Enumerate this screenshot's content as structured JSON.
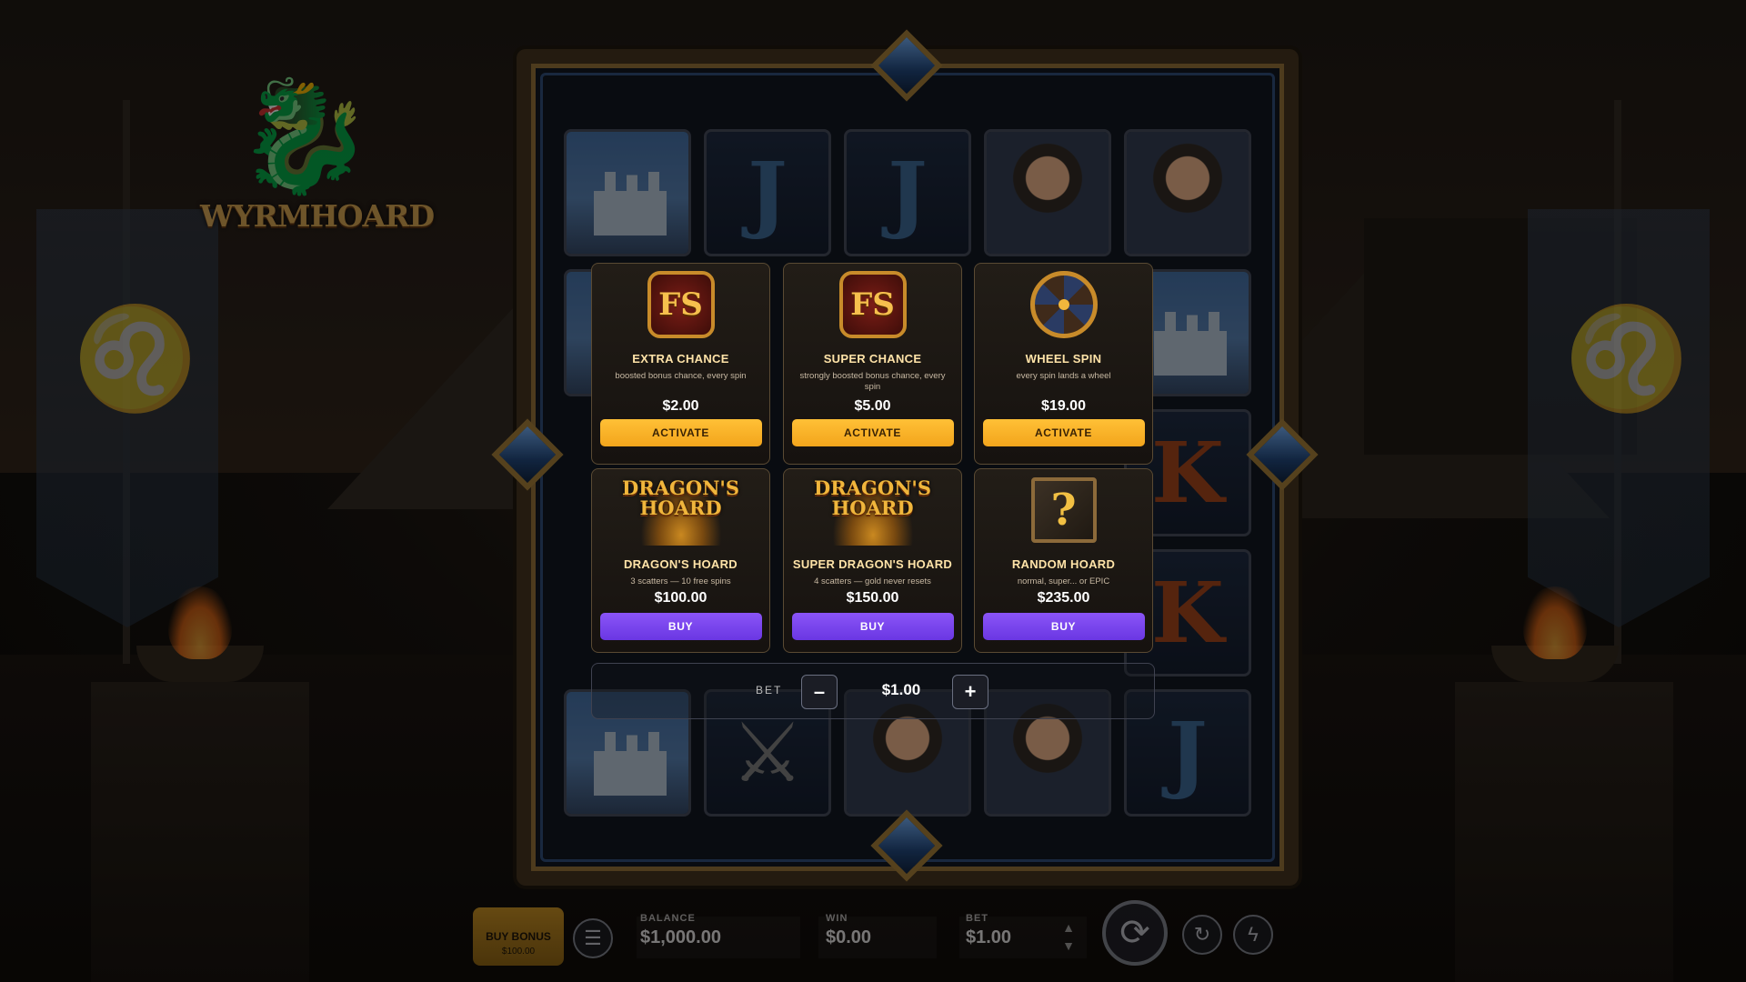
{
  "logo": {
    "text": "WYRMHOARD"
  },
  "shop": {
    "boosts": [
      {
        "title": "EXTRA CHANCE",
        "desc": "boosted bonus chance, every spin",
        "price": "$2.00",
        "button": "ACTIVATE",
        "icon": "fs-scatter-icon",
        "icon_text": "FS"
      },
      {
        "title": "SUPER CHANCE",
        "desc": "strongly boosted bonus chance, every spin",
        "price": "$5.00",
        "button": "ACTIVATE",
        "icon": "fs-scatter-icon",
        "icon_text": "FS"
      },
      {
        "title": "WHEEL SPIN",
        "desc": "every spin lands a wheel",
        "price": "$19.00",
        "button": "ACTIVATE",
        "icon": "wheel-icon"
      }
    ],
    "bonuses": [
      {
        "title": "DRAGON'S HOARD",
        "desc": "3 scatters — 10 free spins",
        "price": "$100.00",
        "button": "BUY",
        "icon": "dragons-hoard-icon",
        "icon_line1": "DRAGON'S",
        "icon_line2": "HOARD"
      },
      {
        "title": "SUPER DRAGON'S HOARD",
        "desc": "4 scatters — gold never resets",
        "price": "$150.00",
        "button": "BUY",
        "icon": "dragons-hoard-icon",
        "icon_line1": "DRAGON'S",
        "icon_line2": "HOARD"
      },
      {
        "title": "RANDOM HOARD",
        "desc": "normal, super... or EPIC",
        "price": "$235.00",
        "button": "BUY",
        "icon": "mystery-box-icon",
        "icon_text": "?"
      }
    ],
    "bet": {
      "label": "BET",
      "value": "$1.00",
      "minus": "–",
      "plus": "+"
    }
  },
  "hud": {
    "buy_bonus": {
      "label": "BUY BONUS",
      "price": "$100.00"
    },
    "balance": {
      "label": "BALANCE",
      "value": "$1,000.00"
    },
    "win": {
      "label": "WIN",
      "value": "$0.00"
    },
    "bet": {
      "label": "BET",
      "value": "$1.00"
    }
  },
  "colors": {
    "activate": "#f3a51c",
    "buy": "#6a37e3",
    "frame_gold": "#7c6030",
    "frame_blue": "#294266"
  },
  "reels": {
    "grid": [
      [
        "castle",
        "J",
        "J",
        "knight",
        "knight"
      ],
      [
        "castle",
        "",
        "",
        "",
        "castle"
      ],
      [
        "",
        "",
        "",
        "",
        "K"
      ],
      [
        "",
        "",
        "",
        "",
        "K"
      ],
      [
        "castle",
        "swords",
        "knight",
        "knight",
        "J"
      ]
    ]
  }
}
